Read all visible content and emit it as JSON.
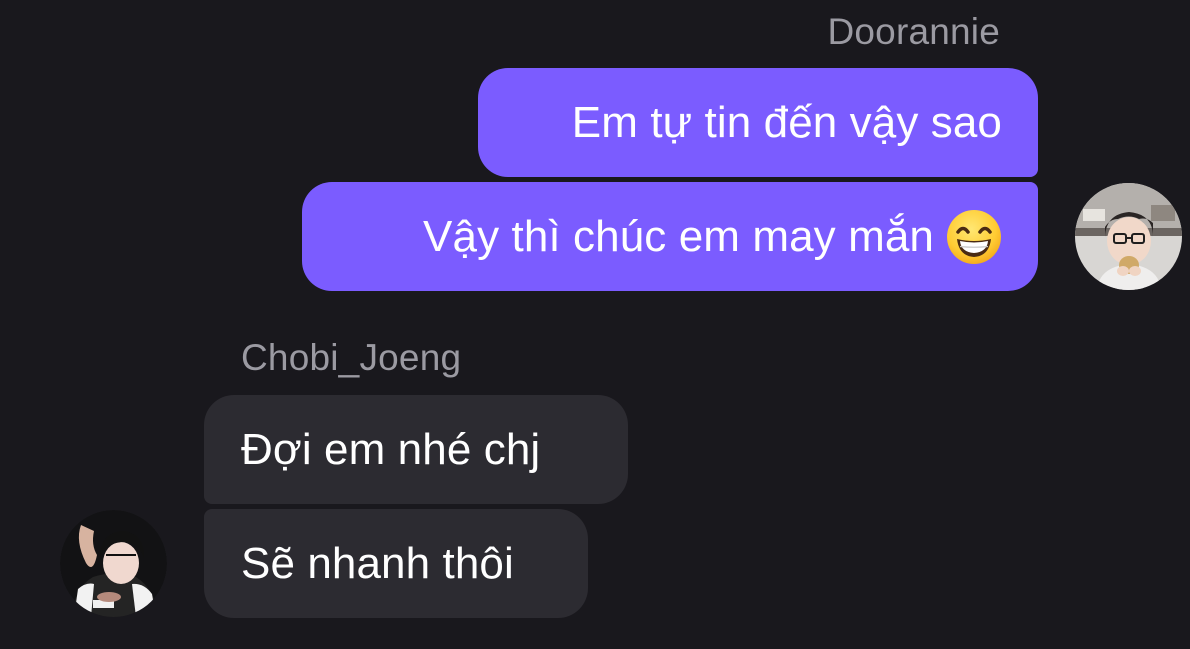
{
  "conversation": {
    "outgoing_group": {
      "sender_name": "Doorannie",
      "messages": [
        {
          "text": "Em tự tin đến vậy sao"
        },
        {
          "text": "Vậy thì chúc em may mắn",
          "emoji": "grinning-face-with-smiling-eyes"
        }
      ],
      "avatar": "doorannie-avatar"
    },
    "incoming_group": {
      "sender_name": "Chobi_Joeng",
      "messages": [
        {
          "text": "Đợi em nhé chj"
        },
        {
          "text": "Sẽ nhanh thôi"
        }
      ],
      "avatar": "chobi-joeng-avatar"
    }
  },
  "colors": {
    "background": "#19181d",
    "outgoing_bubble": "#7b5cff",
    "incoming_bubble": "#2c2b31",
    "sender_name": "#9b9aa2",
    "message_text": "#ffffff"
  }
}
